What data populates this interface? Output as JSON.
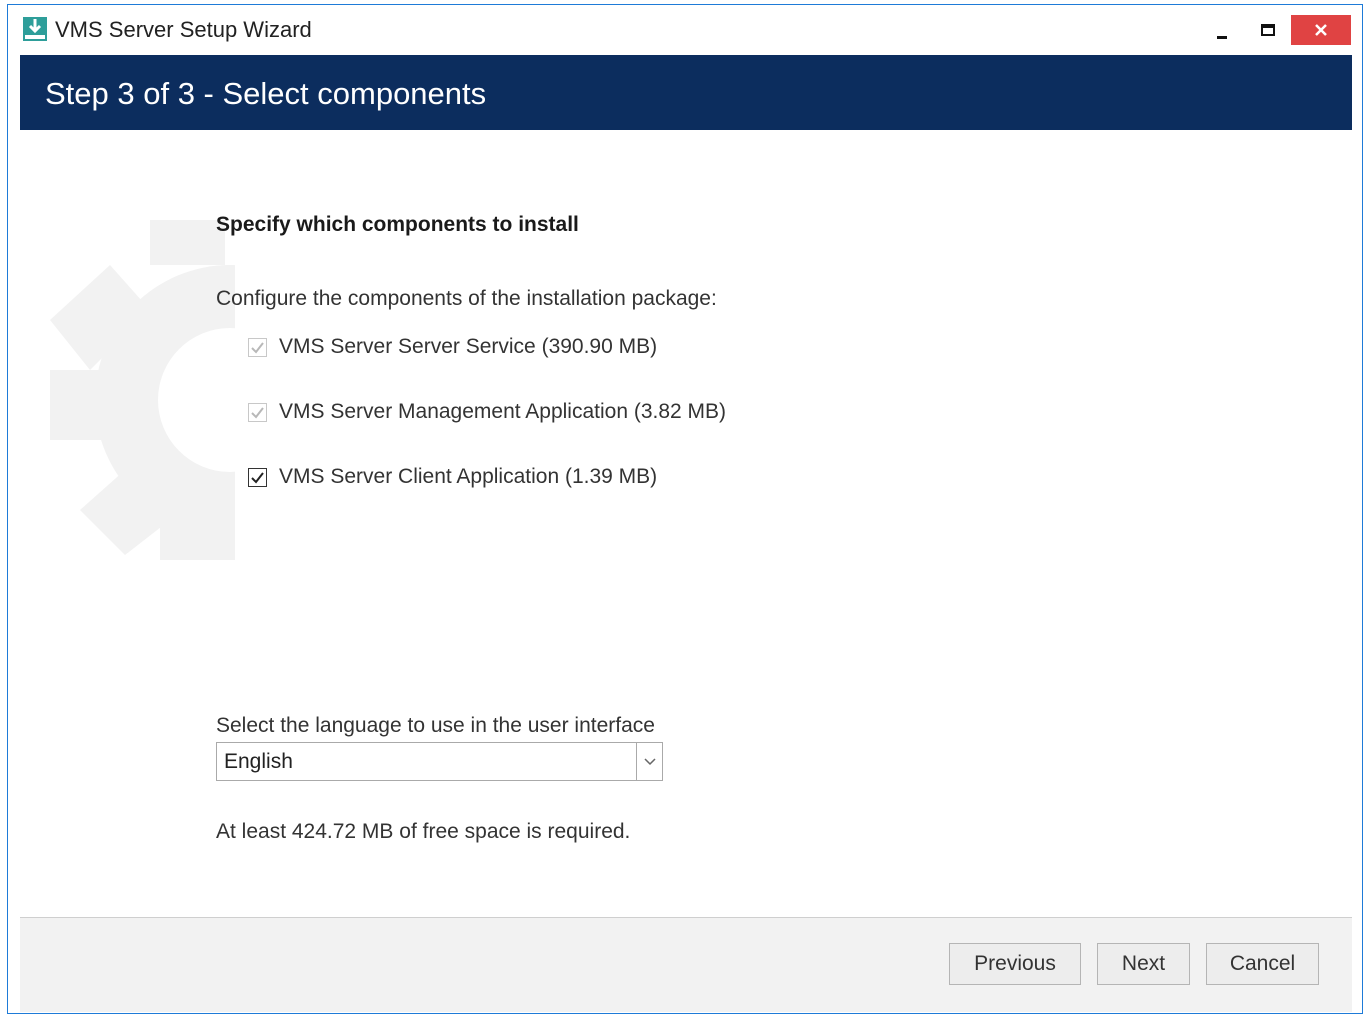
{
  "window": {
    "title": "VMS Server Setup Wizard",
    "icons": {
      "app": "installer-download-icon",
      "minimize": "minimize-icon",
      "maximize": "maximize-icon",
      "close": "close-icon"
    }
  },
  "header": {
    "step_title": "Step 3 of 3 - Select components"
  },
  "main": {
    "heading": "Specify which components to install",
    "configure_label": "Configure the components of the installation package:",
    "components": [
      {
        "label": "VMS Server Server Service (390.90 MB)",
        "checked": true,
        "enabled": false
      },
      {
        "label": "VMS Server Management Application (3.82 MB)",
        "checked": true,
        "enabled": false
      },
      {
        "label": "VMS Server Client Application (1.39 MB)",
        "checked": true,
        "enabled": true
      }
    ],
    "language_label": "Select the language to use in the user interface",
    "language_selected": "English",
    "space_required": "At least 424.72 MB of free space is required.",
    "background_icon": "gear-icon"
  },
  "footer": {
    "previous_label": "Previous",
    "next_label": "Next",
    "cancel_label": "Cancel"
  },
  "colors": {
    "header_band": "#0c2d5e",
    "close_button": "#e04343",
    "window_border": "#1e7bd8"
  }
}
